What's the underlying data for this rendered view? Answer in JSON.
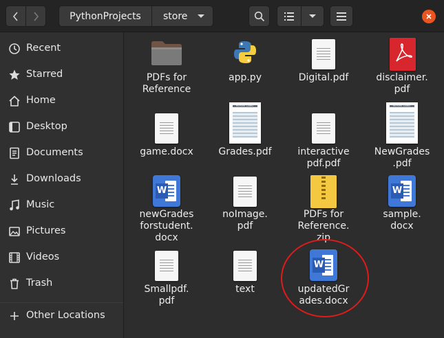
{
  "header": {
    "path": [
      "PythonProjects",
      "store"
    ]
  },
  "sidebar": {
    "items": [
      {
        "label": "Recent",
        "icon": "clock-icon"
      },
      {
        "label": "Starred",
        "icon": "star-icon"
      },
      {
        "label": "Home",
        "icon": "home-icon"
      },
      {
        "label": "Desktop",
        "icon": "desktop-icon"
      },
      {
        "label": "Documents",
        "icon": "documents-icon"
      },
      {
        "label": "Downloads",
        "icon": "download-icon"
      },
      {
        "label": "Music",
        "icon": "music-icon"
      },
      {
        "label": "Pictures",
        "icon": "pictures-icon"
      },
      {
        "label": "Videos",
        "icon": "videos-icon"
      },
      {
        "label": "Trash",
        "icon": "trash-icon"
      }
    ],
    "other_locations": {
      "label": "Other Locations",
      "icon": "plus-icon"
    }
  },
  "files": [
    {
      "name": "PDFs for\nReference",
      "type": "folder"
    },
    {
      "name": "app.py",
      "type": "python"
    },
    {
      "name": "Digital.pdf",
      "type": "document"
    },
    {
      "name": "disclaimer.\npdf",
      "type": "pdf-red"
    },
    {
      "name": "game.docx",
      "type": "document"
    },
    {
      "name": "Grades.pdf",
      "type": "report-card"
    },
    {
      "name": "interactive\npdf.pdf",
      "type": "document"
    },
    {
      "name": "NewGrades\n.pdf",
      "type": "report-card"
    },
    {
      "name": "newGrades\nforstudent.\ndocx",
      "type": "word"
    },
    {
      "name": "noImage.\npdf",
      "type": "document"
    },
    {
      "name": "PDFs for\nReference.\nzip",
      "type": "zip"
    },
    {
      "name": "sample.\ndocx",
      "type": "word"
    },
    {
      "name": "Smallpdf.\npdf",
      "type": "document"
    },
    {
      "name": "text",
      "type": "document"
    },
    {
      "name": "updatedGr\nades.docx",
      "type": "word"
    }
  ],
  "report_card_title": "REPORT CARD",
  "word_letter": "W",
  "colors": {
    "accent": "#e95420",
    "highlight_circle": "#e01b1b",
    "word_blue": "#3f78d6",
    "pdf_red": "#d8262f"
  }
}
